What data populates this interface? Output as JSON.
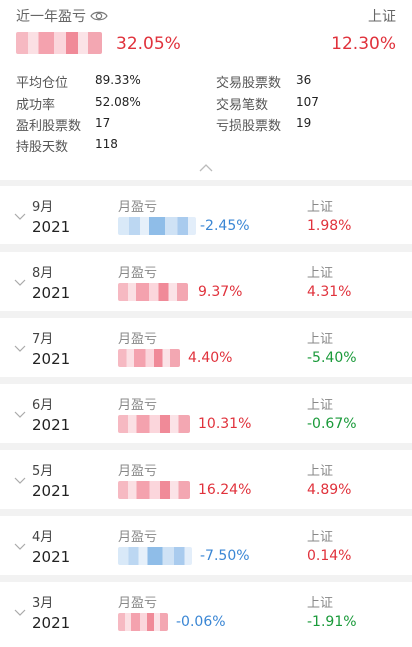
{
  "summary": {
    "period_label": "近一年盈亏",
    "return": "32.05%",
    "benchmark_label": "上证",
    "benchmark_return": "12.30%",
    "stats": [
      {
        "label": "平均仓位",
        "value": "89.33%"
      },
      {
        "label": "交易股票数",
        "value": "36"
      },
      {
        "label": "成功率",
        "value": "52.08%"
      },
      {
        "label": "交易笔数",
        "value": "107"
      },
      {
        "label": "盈利股票数",
        "value": "17"
      },
      {
        "label": "亏损股票数",
        "value": "19"
      },
      {
        "label": "持股天数",
        "value": "118"
      }
    ]
  },
  "months": [
    {
      "month": "9月",
      "year": "2021",
      "label": "月盈亏",
      "ret": "-2.45%",
      "bench_label": "上证",
      "bench": "1.98%"
    },
    {
      "month": "8月",
      "year": "2021",
      "label": "月盈亏",
      "ret": "9.37%",
      "bench_label": "上证",
      "bench": "4.31%"
    },
    {
      "month": "7月",
      "year": "2021",
      "label": "月盈亏",
      "ret": "4.40%",
      "bench_label": "上证",
      "bench": "-5.40%"
    },
    {
      "month": "6月",
      "year": "2021",
      "label": "月盈亏",
      "ret": "10.31%",
      "bench_label": "上证",
      "bench": "-0.67%"
    },
    {
      "month": "5月",
      "year": "2021",
      "label": "月盈亏",
      "ret": "16.24%",
      "bench_label": "上证",
      "bench": "4.89%"
    },
    {
      "month": "4月",
      "year": "2021",
      "label": "月盈亏",
      "ret": "-7.50%",
      "bench_label": "上证",
      "bench": "0.14%"
    },
    {
      "month": "3月",
      "year": "2021",
      "label": "月盈亏",
      "ret": "-0.06%",
      "bench_label": "上证",
      "bench": "-1.91%"
    }
  ],
  "colors": {
    "positive": "#e0323c",
    "negative_return": "#3a86d4",
    "negative_bench": "#1a9a3a"
  },
  "icons": {
    "visibility": "eye-icon",
    "collapse": "chevron-up-icon",
    "expand": "chevron-down-icon"
  }
}
